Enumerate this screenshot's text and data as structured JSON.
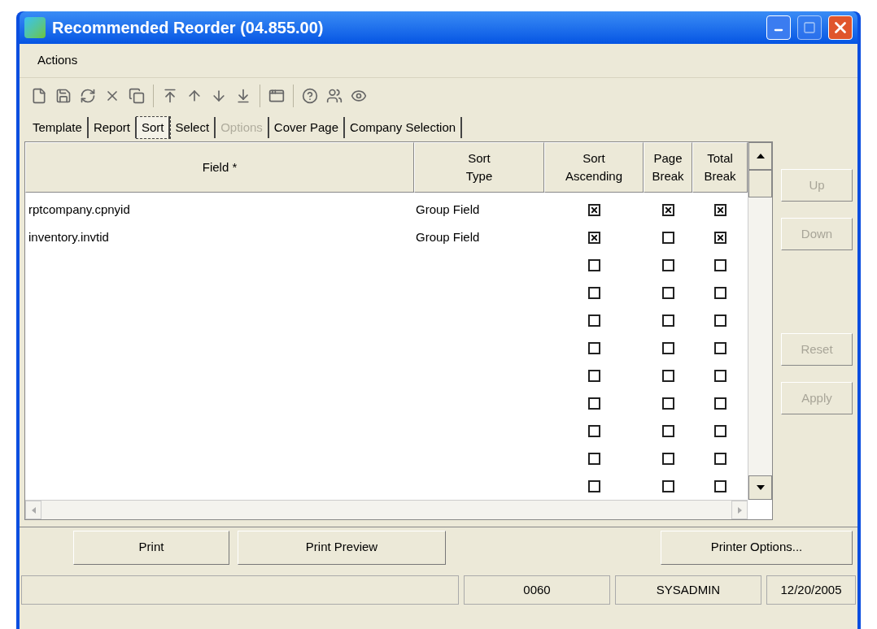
{
  "window": {
    "title": "Recommended Reorder (04.855.00)"
  },
  "menu": [
    "Actions"
  ],
  "tabs": [
    {
      "label": "Template",
      "selected": false,
      "disabled": false
    },
    {
      "label": "Report",
      "selected": false,
      "disabled": false
    },
    {
      "label": "Sort",
      "selected": true,
      "disabled": false
    },
    {
      "label": "Select",
      "selected": false,
      "disabled": false
    },
    {
      "label": "Options",
      "selected": false,
      "disabled": true
    },
    {
      "label": "Cover Page",
      "selected": false,
      "disabled": false
    },
    {
      "label": "Company Selection",
      "selected": false,
      "disabled": false
    }
  ],
  "table": {
    "columns": [
      "Field *",
      "Sort Type",
      "Sort Ascending",
      "Page Break",
      "Total Break"
    ],
    "rows": [
      {
        "field": "rptcompany.cpnyid",
        "sort_type": "Group Field",
        "sort_ascending": true,
        "page_break": true,
        "total_break": true
      },
      {
        "field": "inventory.invtid",
        "sort_type": "Group Field",
        "sort_ascending": true,
        "page_break": false,
        "total_break": true
      },
      {
        "sort_ascending": false,
        "page_break": false,
        "total_break": false
      },
      {
        "sort_ascending": false,
        "page_break": false,
        "total_break": false
      },
      {
        "sort_ascending": false,
        "page_break": false,
        "total_break": false
      },
      {
        "sort_ascending": false,
        "page_break": false,
        "total_break": false
      },
      {
        "sort_ascending": false,
        "page_break": false,
        "total_break": false
      },
      {
        "sort_ascending": false,
        "page_break": false,
        "total_break": false
      },
      {
        "sort_ascending": false,
        "page_break": false,
        "total_break": false
      },
      {
        "sort_ascending": false,
        "page_break": false,
        "total_break": false
      },
      {
        "sort_ascending": false,
        "page_break": false,
        "total_break": false
      }
    ]
  },
  "side_buttons": [
    {
      "label": "Up",
      "disabled": true
    },
    {
      "label": "Down",
      "disabled": true
    },
    {
      "label": "Reset",
      "disabled": true
    },
    {
      "label": "Apply",
      "disabled": true
    }
  ],
  "bottom_buttons": [
    "Print",
    "Print Preview",
    "Printer Options..."
  ],
  "status_bar": [
    "0060",
    "SYSADMIN",
    "12/20/2005"
  ]
}
